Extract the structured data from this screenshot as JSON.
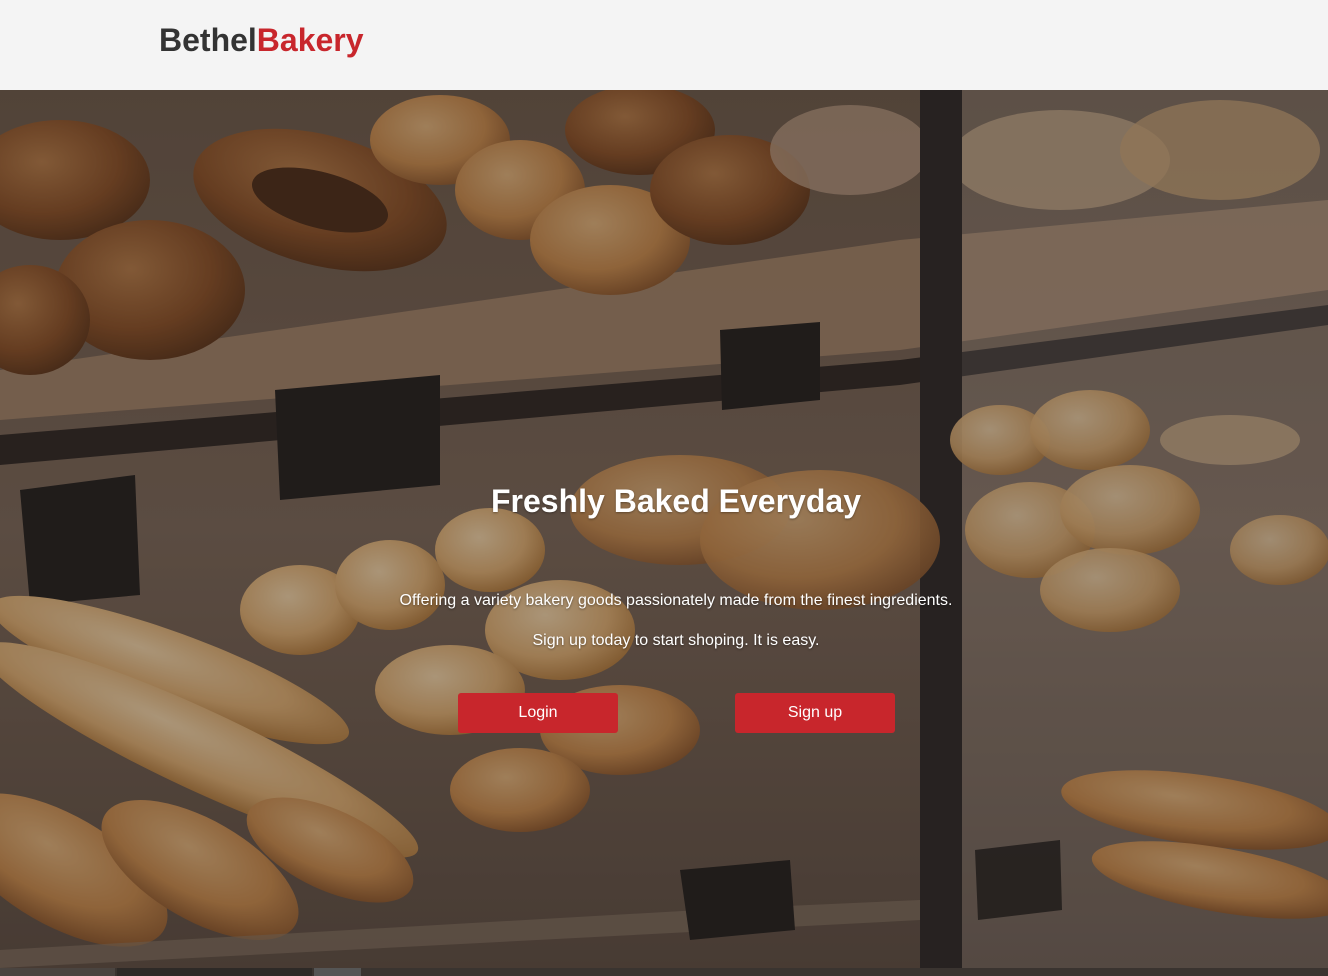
{
  "brand": {
    "name_part1": "Bethel",
    "name_part2": "Bakery",
    "color_dark": "#333333",
    "color_accent": "#c8262c"
  },
  "hero": {
    "headline": "Freshly Baked Everyday",
    "tagline": "Offering a variety bakery goods passionately made from the finest ingredients.",
    "cta_text": "Sign up today to start shoping. It is easy.",
    "background_image": "bakery-display-case-photo",
    "buttons": {
      "login_label": "Login",
      "signup_label": "Sign up"
    }
  }
}
